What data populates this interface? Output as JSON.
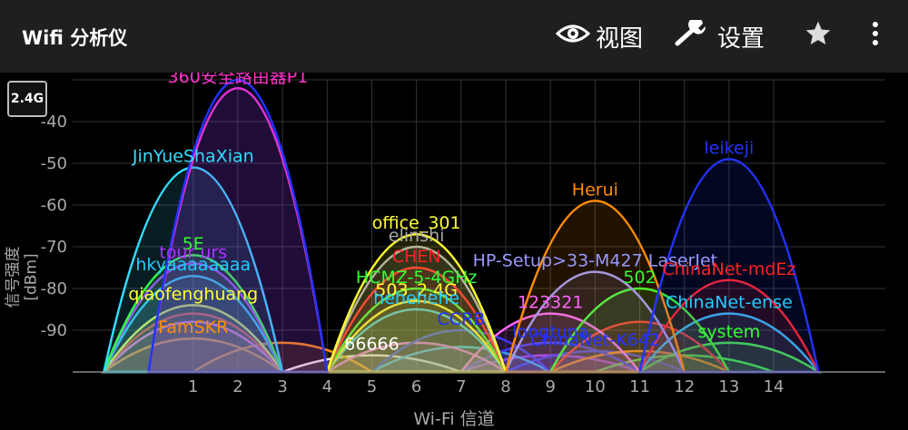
{
  "app": {
    "title": "Wifi 分析仪"
  },
  "toolbar": {
    "view_label": "视图",
    "settings_label": "设置",
    "view_icon": "eye-icon",
    "settings_icon": "wrench-icon",
    "favorite_icon": "star-icon",
    "menu_icon": "more-vert-icon"
  },
  "band": {
    "label": "2.4G"
  },
  "chart_data": {
    "type": "area",
    "xlabel": "Wi-Fi 信道",
    "ylabel": "信号强度 [dBm]",
    "x_ticks": [
      1,
      2,
      3,
      4,
      5,
      6,
      7,
      8,
      9,
      10,
      11,
      12,
      13,
      14
    ],
    "y_ticks": [
      -40,
      -50,
      -60,
      -70,
      -80,
      -90
    ],
    "xlim": [
      -1.7,
      16.5
    ],
    "ylim": [
      -100,
      -30
    ],
    "grid": true,
    "series": [
      {
        "name": "360安全路由器P1",
        "channel": 2,
        "signal": -32,
        "color": "#ff33cc"
      },
      {
        "name": "",
        "channel": 2,
        "signal": -30,
        "color": "#2233ff"
      },
      {
        "name": "JinYueShaXian",
        "channel": 1,
        "signal": -51,
        "color": "#33ddff"
      },
      {
        "name": "leikeji",
        "channel": 13,
        "signal": -49,
        "color": "#2233ff"
      },
      {
        "name": "Herui",
        "channel": 10,
        "signal": -59,
        "color": "#ff8c00"
      },
      {
        "name": "office_301",
        "channel": 6,
        "signal": -67,
        "color": "#ffff33"
      },
      {
        "name": "elinshi",
        "channel": 6,
        "signal": -70,
        "color": "#aaaaaa"
      },
      {
        "name": "HP-Setup>33-M427 LaserJet",
        "channel": 10,
        "signal": -76,
        "color": "#9999ff"
      },
      {
        "name": "5E",
        "channel": 1,
        "signal": -72,
        "color": "#33ff33"
      },
      {
        "name": "tour urs",
        "channel": 1,
        "signal": -74,
        "color": "#aa33ff"
      },
      {
        "name": "hkyaaaaaaaa",
        "channel": 1,
        "signal": -77,
        "color": "#22ccff"
      },
      {
        "name": "qiaofenghuang",
        "channel": 1,
        "signal": -84,
        "color": "#ffff33"
      },
      {
        "name": "CHEN",
        "channel": 6,
        "signal": -75,
        "color": "#ff2222"
      },
      {
        "name": "HCMZ-5-4GHz",
        "channel": 6,
        "signal": -80,
        "color": "#33ff33"
      },
      {
        "name": "503_2.4G",
        "channel": 6,
        "signal": -83,
        "color": "#ffff33"
      },
      {
        "name": "hehehehe",
        "channel": 6,
        "signal": -85,
        "color": "#22ccff"
      },
      {
        "name": "66666",
        "channel": 5,
        "signal": -96,
        "color": "#ffffff"
      },
      {
        "name": "CCRB",
        "channel": 7,
        "signal": -90,
        "color": "#2233ff"
      },
      {
        "name": "123321",
        "channel": 9,
        "signal": -86,
        "color": "#ff66ff"
      },
      {
        "name": "502",
        "channel": 11,
        "signal": -80,
        "color": "#33ff33"
      },
      {
        "name": "ChinaNet-mdEz",
        "channel": 13,
        "signal": -78,
        "color": "#ff2222"
      },
      {
        "name": "ChinaNet-ense",
        "channel": 13,
        "signal": -86,
        "color": "#22ccff"
      },
      {
        "name": "system",
        "channel": 13,
        "signal": -93,
        "color": "#33ff33"
      },
      {
        "name": "ChinaNet-K642",
        "channel": 10,
        "signal": -95,
        "color": "#2233ff"
      },
      {
        "name": "longtuna",
        "channel": 9,
        "signal": -93,
        "color": "#2233ff"
      },
      {
        "name": "FamSKR",
        "channel": 1,
        "signal": -92,
        "color": "#ff8c00"
      },
      {
        "name": "",
        "channel": 1,
        "signal": -88,
        "color": "#ff66ff"
      },
      {
        "name": "",
        "channel": 1,
        "signal": -86,
        "color": "#ff2222"
      },
      {
        "name": "",
        "channel": 3,
        "signal": -93,
        "color": "#ff8c00"
      },
      {
        "name": "",
        "channel": 6,
        "signal": -93,
        "color": "#ff66ff"
      },
      {
        "name": "",
        "channel": 7,
        "signal": -94,
        "color": "#22ccff"
      },
      {
        "name": "",
        "channel": 9,
        "signal": -96,
        "color": "#aa33ff"
      },
      {
        "name": "",
        "channel": 11,
        "signal": -95,
        "color": "#ff8c00"
      },
      {
        "name": "",
        "channel": 12,
        "signal": -96,
        "color": "#33ff33"
      },
      {
        "name": "",
        "channel": 11,
        "signal": -88,
        "color": "#ff2222"
      }
    ]
  }
}
